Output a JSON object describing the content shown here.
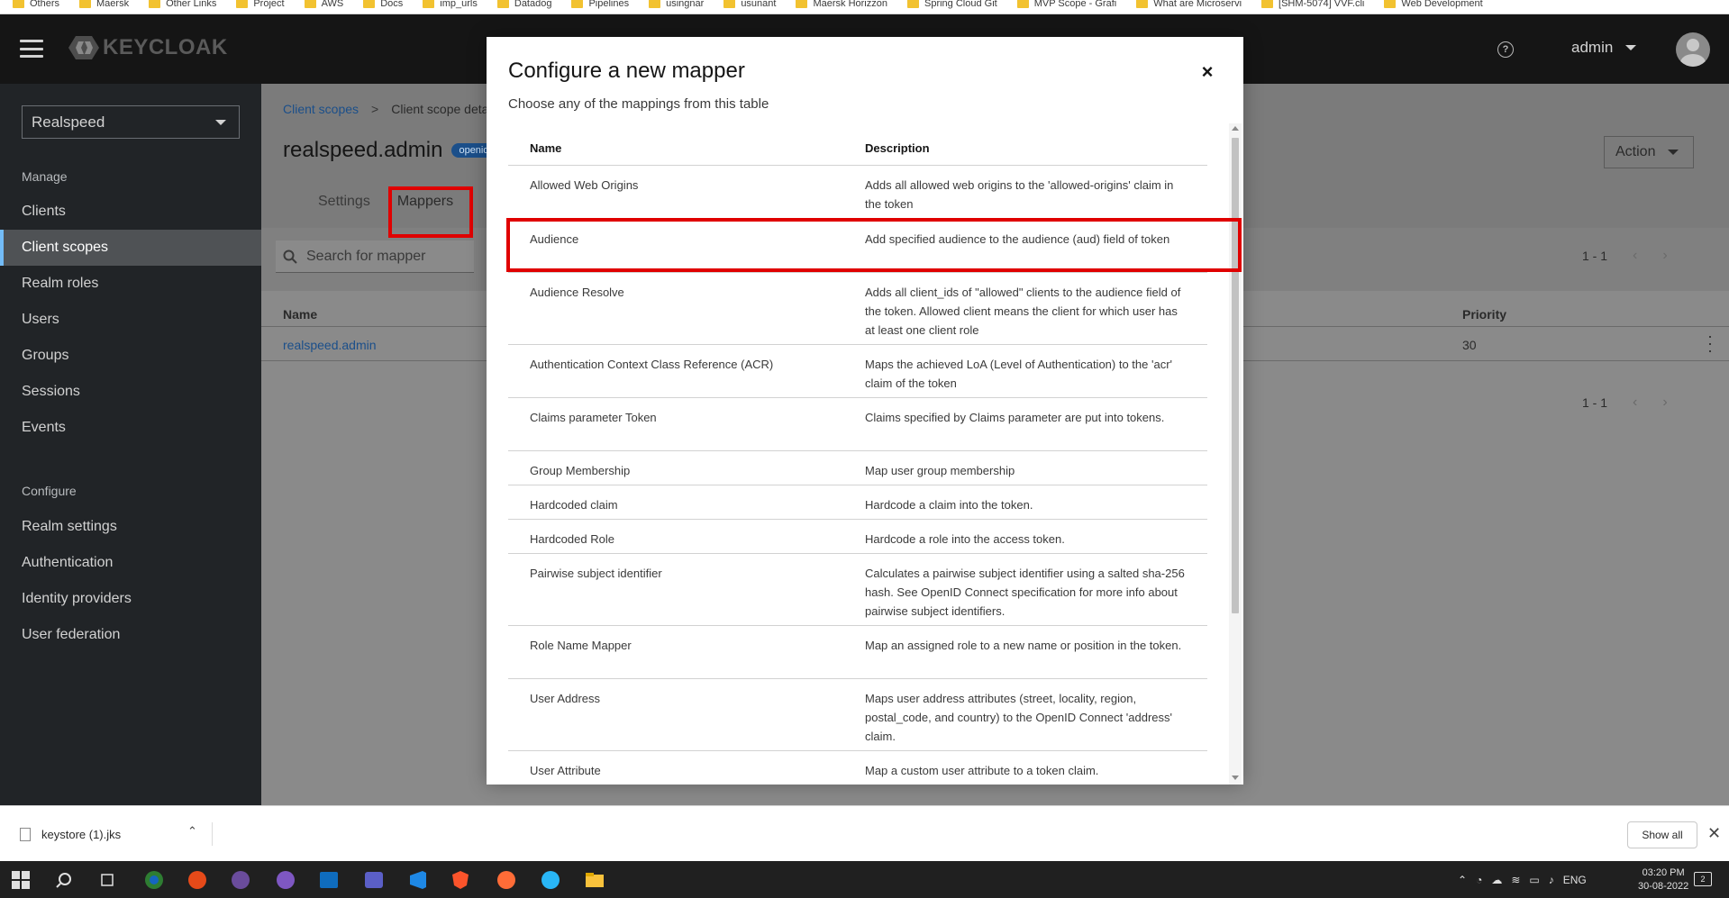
{
  "bookmarks": [
    "Others",
    "Maersk",
    "Other Links",
    "Project",
    "AWS",
    "Docs",
    "imp_urls",
    "Datadog",
    "Pipelines",
    "usingnar",
    "usunant",
    "Maersk Horizzon",
    "Spring Cloud Git",
    "MVP Scope - Grafi",
    "What are Microservi",
    "[SHM-5074] VVF.cli",
    "Web Development"
  ],
  "masthead": {
    "brand": "KEYCLOAK",
    "help": "?",
    "user": "admin"
  },
  "sidebar": {
    "realm": "Realspeed",
    "manage_heading": "Manage",
    "manage_items": [
      {
        "label": "Clients"
      },
      {
        "label": "Client scopes"
      },
      {
        "label": "Realm roles"
      },
      {
        "label": "Users"
      },
      {
        "label": "Groups"
      },
      {
        "label": "Sessions"
      },
      {
        "label": "Events"
      }
    ],
    "configure_heading": "Configure",
    "configure_items": [
      {
        "label": "Realm settings"
      },
      {
        "label": "Authentication"
      },
      {
        "label": "Identity providers"
      },
      {
        "label": "User federation"
      }
    ]
  },
  "page": {
    "breadcrumb_root": "Client scopes",
    "breadcrumb_sep": ">",
    "breadcrumb_current": "Client scope details",
    "title": "realspeed.admin",
    "badge": "openid",
    "action": "Action",
    "tabs": [
      {
        "label": "Settings"
      },
      {
        "label": "Mappers"
      }
    ],
    "search_placeholder": "Search for mapper",
    "pager": "1 - 1",
    "table": {
      "col_name": "Name",
      "col_priority": "Priority",
      "row_name": "realspeed.admin",
      "row_priority": "30"
    }
  },
  "modal": {
    "title": "Configure a new mapper",
    "subtitle": "Choose any of the mappings from this table",
    "close": "×",
    "col_name": "Name",
    "col_description": "Description",
    "rows": [
      {
        "name": "Allowed Web Origins",
        "description": "Adds all allowed web origins to the 'allowed-origins' claim in the token"
      },
      {
        "name": "Audience",
        "description": "Add specified audience to the audience (aud) field of token"
      },
      {
        "name": "Audience Resolve",
        "description": "Adds all client_ids of \"allowed\" clients to the audience field of the token. Allowed client means the client for which user has at least one client role"
      },
      {
        "name": "Authentication Context Class Reference (ACR)",
        "description": "Maps the achieved LoA (Level of Authentication) to the 'acr' claim of the token"
      },
      {
        "name": "Claims parameter Token",
        "description": "Claims specified by Claims parameter are put into tokens."
      },
      {
        "name": "Group Membership",
        "description": "Map user group membership"
      },
      {
        "name": "Hardcoded claim",
        "description": "Hardcode a claim into the token."
      },
      {
        "name": "Hardcoded Role",
        "description": "Hardcode a role into the access token."
      },
      {
        "name": "Pairwise subject identifier",
        "description": "Calculates a pairwise subject identifier using a salted sha-256 hash. See OpenID Connect specification for more info about pairwise subject identifiers."
      },
      {
        "name": "Role Name Mapper",
        "description": "Map an assigned role to a new name or position in the token."
      },
      {
        "name": "User Address",
        "description": "Maps user address attributes (street, locality, region, postal_code, and country) to the OpenID Connect 'address' claim."
      },
      {
        "name": "User Attribute",
        "description": "Map a custom user attribute to a token claim."
      }
    ]
  },
  "download_bar": {
    "file": "keystore (1).jks",
    "show_all": "Show all"
  },
  "taskbar": {
    "lang": "ENG",
    "time": "03:20 PM",
    "date": "30-08-2022",
    "notifications": "2"
  },
  "colors": {
    "highlight": "#e00000",
    "link": "#1b4f8a",
    "sidebar": "#212427"
  }
}
